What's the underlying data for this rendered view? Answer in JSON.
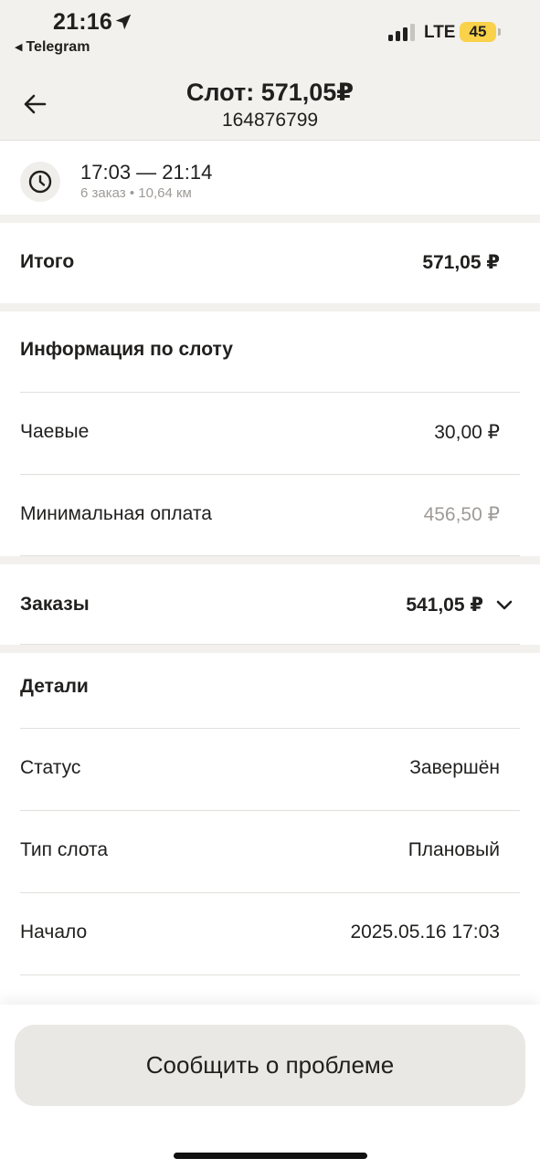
{
  "status_bar": {
    "time": "21:16",
    "back_app": "Telegram",
    "network": "LTE",
    "battery": "45"
  },
  "header": {
    "title": "Слот: 571,05₽",
    "subtitle": "164876799"
  },
  "slot_time": {
    "range": "17:03 — 21:14",
    "meta": "6 заказ • 10,64 км"
  },
  "total": {
    "label": "Итого",
    "value": "571,05 ₽"
  },
  "slot_info": {
    "heading": "Информация по слоту",
    "tips_label": "Чаевые",
    "tips_value": "30,00 ₽",
    "min_pay_label": "Минимальная оплата",
    "min_pay_value": "456,50 ₽"
  },
  "orders": {
    "label": "Заказы",
    "value": "541,05 ₽"
  },
  "details": {
    "heading": "Детали",
    "status_label": "Статус",
    "status_value": "Завершён",
    "type_label": "Тип слота",
    "type_value": "Плановый",
    "start_label": "Начало",
    "start_value": "2025.05.16 17:03"
  },
  "actions": {
    "report_label": "Сообщить о проблеме"
  },
  "icons": [
    "location-arrow-icon",
    "signal-icon",
    "back-arrow-icon",
    "clock-icon",
    "chevron-down-icon"
  ],
  "colors": {
    "header_bg": "#f2f1ed",
    "battery": "#f9d24a",
    "muted_text": "#9e9b98",
    "button_bg": "#e9e8e4"
  }
}
